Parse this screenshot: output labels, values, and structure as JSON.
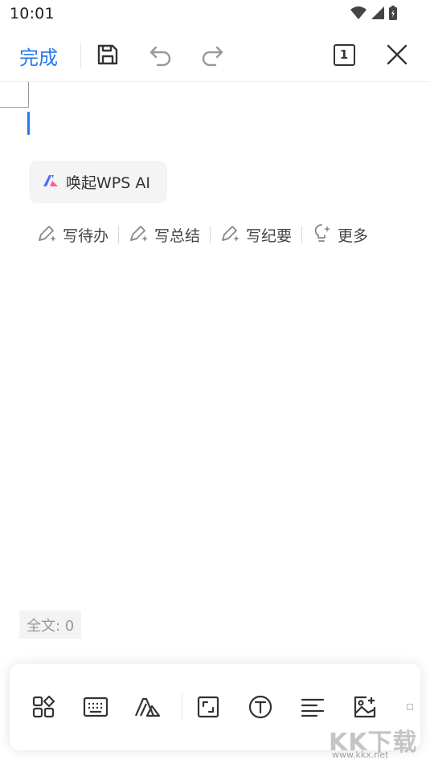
{
  "status_bar": {
    "time": "10:01",
    "icons": [
      "wifi-icon",
      "signal-icon",
      "battery-charging-icon"
    ]
  },
  "toolbar": {
    "done_label": "完成",
    "icons": [
      "save-icon",
      "undo-icon",
      "redo-icon",
      "page-count-icon",
      "close-icon"
    ],
    "page_count": "1",
    "accent_color": "#2878ea"
  },
  "editor": {
    "ai_chip": {
      "label": "唤起WPS AI",
      "icon": "wps-ai-logo-icon"
    },
    "suggestions": [
      {
        "label": "写待办",
        "icon": "pen-sparkle-icon"
      },
      {
        "label": "写总结",
        "icon": "pen-sparkle-icon"
      },
      {
        "label": "写纪要",
        "icon": "pen-sparkle-icon"
      },
      {
        "label": "更多",
        "icon": "bulb-sparkle-icon"
      }
    ],
    "word_count": "全文: 0"
  },
  "bottom_tools": {
    "icons": [
      "apps-icon",
      "keyboard-icon",
      "text-style-icon",
      "fullscreen-icon",
      "font-icon",
      "align-left-icon",
      "insert-image-icon"
    ]
  },
  "watermark": {
    "text": "KK下载",
    "url": "www.kkx.net"
  }
}
